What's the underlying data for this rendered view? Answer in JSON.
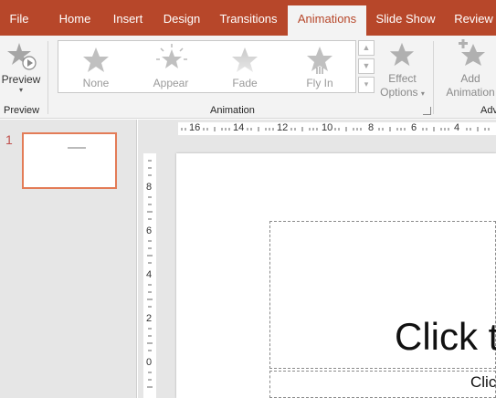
{
  "tabs": [
    {
      "label": "File"
    },
    {
      "label": "Home"
    },
    {
      "label": "Insert"
    },
    {
      "label": "Design"
    },
    {
      "label": "Transitions"
    },
    {
      "label": "Animations",
      "active": true
    },
    {
      "label": "Slide Show"
    },
    {
      "label": "Review"
    }
  ],
  "ribbon": {
    "preview": {
      "label": "Preview",
      "group_label": "Preview"
    },
    "animation_gallery": {
      "items": [
        {
          "label": "None",
          "icon": "star-icon"
        },
        {
          "label": "Appear",
          "icon": "appear-star-icon"
        },
        {
          "label": "Fade",
          "icon": "fade-star-icon"
        },
        {
          "label": "Fly In",
          "icon": "fly-in-star-icon"
        }
      ],
      "group_label": "Animation"
    },
    "effect_options": {
      "line1": "Effect",
      "line2": "Options"
    },
    "add_animation": {
      "line1": "Add",
      "line2": "Animation"
    },
    "advanced_group_label": "Adv"
  },
  "slides_pane": {
    "slide_number": "1"
  },
  "ruler": {
    "horizontal_ticks": [
      "16",
      "14",
      "12",
      "10",
      "8",
      "6",
      "4"
    ],
    "vertical_ticks": [
      "8",
      "6",
      "4",
      "2",
      "0"
    ]
  },
  "slide": {
    "title_placeholder": "Click t",
    "subtitle_placeholder": "Clic"
  },
  "colors": {
    "accent": "#b7472a",
    "ribbon_bg": "#f3f3f3",
    "thumbnail_border": "#e37c57"
  }
}
